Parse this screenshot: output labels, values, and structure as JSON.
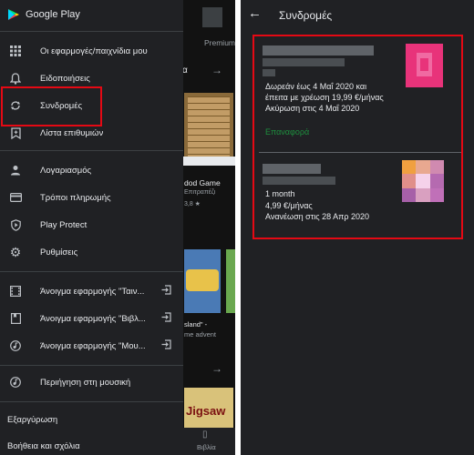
{
  "drawer": {
    "brand": "Google Play",
    "items": [
      {
        "label": "Οι εφαρμογές/παιχνίδια μου",
        "icon": "apps-grid-icon"
      },
      {
        "label": "Ειδοποιήσεις",
        "icon": "bell-icon"
      },
      {
        "label": "Συνδρομές",
        "icon": "refresh-icon"
      },
      {
        "label": "Λίστα επιθυμιών",
        "icon": "bookmark-plus-icon"
      },
      {
        "label": "Λογαριασμός",
        "icon": "person-icon"
      },
      {
        "label": "Τρόποι πληρωμής",
        "icon": "credit-card-icon"
      },
      {
        "label": "Play Protect",
        "icon": "shield-icon"
      },
      {
        "label": "Ρυθμίσεις",
        "icon": "gear-icon"
      },
      {
        "label": "Άνοιγμα εφαρμογής \"Ταιν...",
        "icon": "film-icon"
      },
      {
        "label": "Άνοιγμα εφαρμογής \"Βιβλ...",
        "icon": "book-icon"
      },
      {
        "label": "Άνοιγμα εφαρμογής \"Μου...",
        "icon": "music-icon"
      },
      {
        "label": "Περιήγηση στη μουσική",
        "icon": "music-note-icon"
      }
    ],
    "redeem": "Εξαργύρωση",
    "help": "Βοήθεια και σχόλια"
  },
  "bg_app": {
    "premium": "Premium",
    "tab_fragment": "α",
    "game_title": "dod Game",
    "game_sub": "Επιτραπέζι",
    "game_rating": "3,8 ★",
    "app2_line1": "sland\" -",
    "app2_line2": "me advent",
    "bottom_tab": "Βιβλία",
    "jigsaw_text": "Jigsaw"
  },
  "subscriptions": {
    "title": "Συνδρομές",
    "sub1": {
      "line1": "Δωρεάν έως 4 Μαΐ 2020 και",
      "line2": "έπειτα με χρέωση 19,99 €/μήνας",
      "line3": "Ακύρωση στις 4 Μαΐ 2020",
      "action": "Επαναφορά"
    },
    "sub2": {
      "line1": "1 month",
      "line2": "4,99 €/μήνας",
      "line3": "Ανανέωση στις 28 Απρ 2020"
    }
  },
  "colors": {
    "highlight": "#e50914",
    "accent_green": "#1e8e3e",
    "thumb1": "#e8337a",
    "thumb2": "#d9a0c0"
  }
}
